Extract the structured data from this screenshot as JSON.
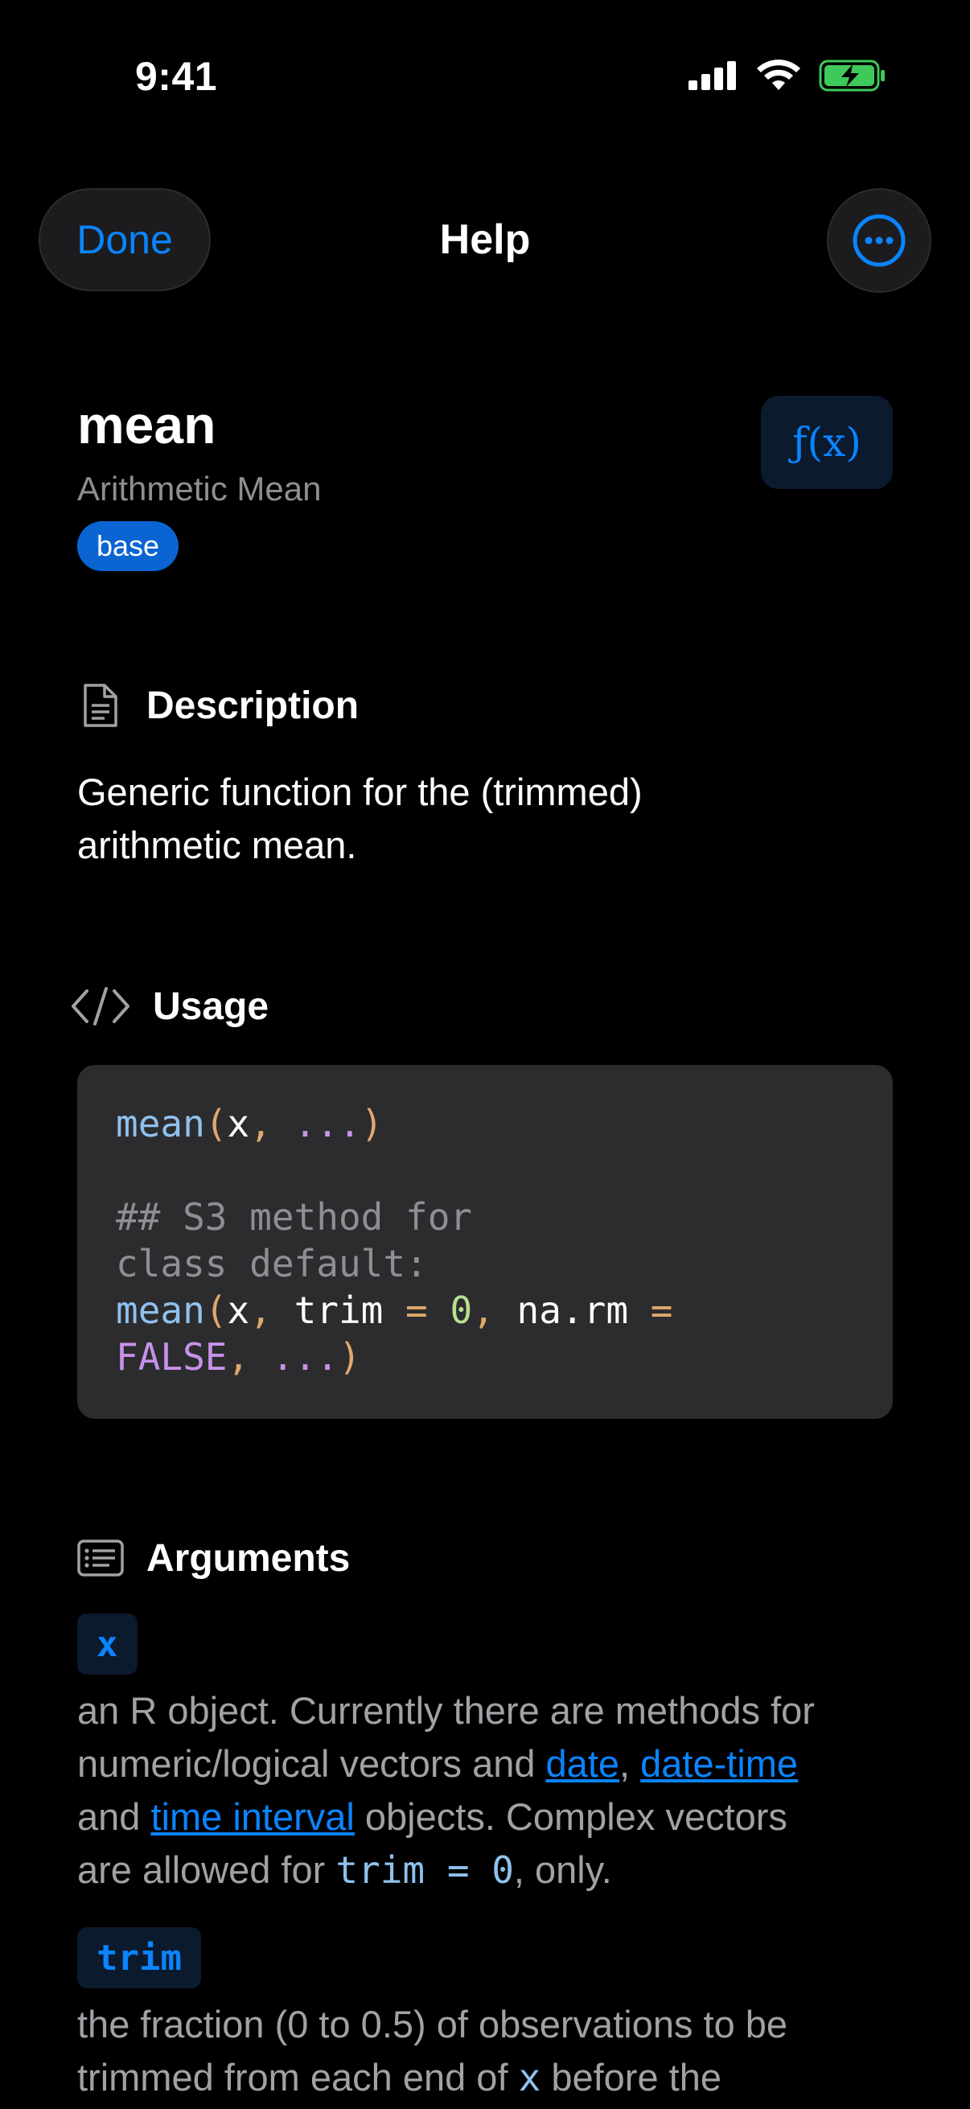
{
  "status": {
    "time": "9:41"
  },
  "nav": {
    "done_label": "Done",
    "title": "Help"
  },
  "function": {
    "name": "mean",
    "title": "Arithmetic Mean",
    "package": "base",
    "fx_label": "ƒ(x)"
  },
  "description": {
    "heading": "Description",
    "text_line1": "Generic function for the (trimmed)",
    "text_line2": "arithmetic mean."
  },
  "usage": {
    "heading": "Usage",
    "l1_fn": "mean",
    "l1_open": "(",
    "l1_arg": "x",
    "l1_comma": ", ",
    "l1_dots": "...",
    "l1_close": ")",
    "comment1": "## S3 method for",
    "comment2": "class default:",
    "l2_fn": "mean",
    "l2_open": "(",
    "l2_x": "x",
    "l2_comma1": ", ",
    "l2_trim": "trim",
    "l2_eq1": " = ",
    "l2_zero": "0",
    "l2_comma2": ", ",
    "l2_narm": "na.rm",
    "l2_eq2": " =",
    "l3_false": "FALSE",
    "l3_comma": ", ",
    "l3_dots": "...",
    "l3_close": ")"
  },
  "arguments": {
    "heading": "Arguments",
    "items": [
      {
        "name": "x",
        "line1": "an R object. Currently there are methods for",
        "line2_pre": "numeric/logical vectors and ",
        "link_date": "date",
        "line2_sep": ", ",
        "link_datetime": "date-time",
        "line3_pre": "and ",
        "link_interval": "time interval",
        "line3_post": " objects. Complex vectors",
        "line4_pre": "are allowed for ",
        "code": "trim = 0",
        "line4_post": ", only."
      },
      {
        "name": "trim",
        "line1": "the fraction (0 to 0.5) of observations to be",
        "line2_pre": "trimmed from each end of ",
        "code": "x",
        "line2_post": " before the"
      }
    ]
  }
}
